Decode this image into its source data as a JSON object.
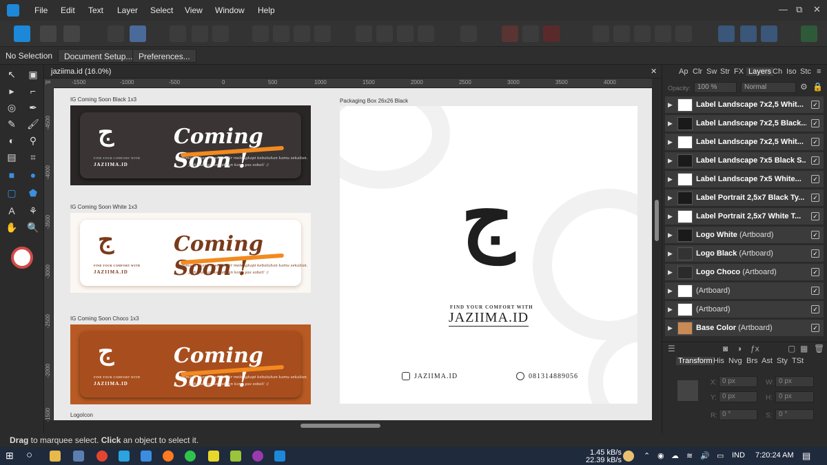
{
  "menubar": {
    "items": [
      "File",
      "Edit",
      "Text",
      "Layer",
      "Select",
      "View",
      "Window",
      "Help"
    ],
    "window_controls": {
      "minimize": "—",
      "restore": "⧉",
      "close": "✕"
    }
  },
  "context": {
    "selection": "No Selection",
    "document_setup": "Document Setup...",
    "preferences": "Preferences..."
  },
  "document": {
    "tab_title": "jaziima.id (16.0%)",
    "close": "✕",
    "ruler_unit": "px",
    "ruler_h": [
      "-1500",
      "-1000",
      "-500",
      "0",
      "500",
      "1000",
      "1500",
      "2000",
      "2500",
      "3000",
      "3500",
      "4000"
    ],
    "ruler_v": [
      "-4500",
      "-4000",
      "-3500",
      "-3000",
      "-2500",
      "-2000",
      "-1500"
    ]
  },
  "artboards": {
    "black": {
      "label": "IG Coming Soon Black 1x3",
      "title": "Coming Soon !",
      "brand": "JAZIIMA.ID",
      "brand_sub": "FIND YOUR COMFORT WITH",
      "line1": "jaziima.id akan segera hadir melengkapi kebutuhan kamu sekalian.",
      "line2": "Jadi, tunggu kehadiran kami yaa sobat! :)",
      "mark": "ج"
    },
    "white": {
      "label": "IG Coming Soon White 1x3",
      "title": "Coming Soon !",
      "brand": "JAZIIMA.ID",
      "brand_sub": "FIND YOUR COMFORT WITH",
      "line1": "jaziima.id akan segera hadir melengkapi kebutuhan kamu sekalian.",
      "line2": "Jadi, tunggu kehadiran kami yaa sobat! :)",
      "mark": "ج"
    },
    "choco": {
      "label": "IG Coming Soon Choco 1x3",
      "title": "Coming Soon !",
      "brand": "JAZIIMA.ID",
      "brand_sub": "FIND YOUR COMFORT WITH",
      "line1": "jaziima.id akan segera hadir melengkapi kebutuhan kamu sekalian.",
      "line2": "Jadi, tunggu kehadiran kami yaa sobat! :)",
      "mark": "ج"
    },
    "logoicon": {
      "label": "LogoIcon"
    },
    "box": {
      "label": "Packaging Box 26x26 Black",
      "mark": "ج",
      "tagline": "FIND YOUR COMFORT WITH",
      "brand": "JAZIIMA.ID",
      "instagram": "JAZIIMA.ID",
      "whatsapp": "081314889056"
    }
  },
  "panel": {
    "tabs": [
      "Ap",
      "Clr",
      "Sw",
      "Str",
      "FX",
      "Layers",
      "Ch",
      "Iso",
      "Stc"
    ],
    "active_tab": "Layers",
    "opacity_label": "Opacity:",
    "opacity": "100 %",
    "blend": "Normal",
    "layers": [
      {
        "name": "Label Landscape 7x2,5 Whit...",
        "sub": "",
        "thumb": "#ffffff"
      },
      {
        "name": "Label Landscape 7x2,5 Black...",
        "sub": "",
        "thumb": "#1a1a1a"
      },
      {
        "name": "Label Landscape 7x2,5 Whit...",
        "sub": "",
        "thumb": "#ffffff"
      },
      {
        "name": "Label Landscape 7x5 Black S...",
        "sub": "",
        "thumb": "#1a1a1a"
      },
      {
        "name": "Label Landscape 7x5 White...",
        "sub": "",
        "thumb": "#ffffff"
      },
      {
        "name": "Label Portrait 2,5x7 Black Ty...",
        "sub": "",
        "thumb": "#1a1a1a"
      },
      {
        "name": "Label Portrait 2,5x7 White T...",
        "sub": "",
        "thumb": "#ffffff"
      },
      {
        "name": "Logo White",
        "sub": "(Artboard)",
        "thumb": "#1a1a1a"
      },
      {
        "name": "Logo Black",
        "sub": "(Artboard)",
        "thumb": "#333333"
      },
      {
        "name": "Logo Choco",
        "sub": "(Artboard)",
        "thumb": "#2b2b2b"
      },
      {
        "name": "",
        "sub": "(Artboard)",
        "thumb": "#ffffff"
      },
      {
        "name": "",
        "sub": "(Artboard)",
        "thumb": "#ffffff"
      },
      {
        "name": "Base Color",
        "sub": "(Artboard)",
        "thumb": "#c98a55"
      }
    ],
    "bottom_tabs": [
      "Transform",
      "His",
      "Nvg",
      "Brs",
      "Ast",
      "Sty",
      "TSt"
    ],
    "active_bottom_tab": "Transform",
    "transform": {
      "x_label": "X:",
      "y_label": "Y:",
      "w_label": "W:",
      "h_label": "H:",
      "r_label": "R:",
      "s_label": "S:",
      "x": "0 px",
      "y": "0 px",
      "w": "0 px",
      "h": "0 px",
      "r": "0 °",
      "s": "0 °"
    }
  },
  "status": {
    "bold1": "Drag",
    "text1": " to marquee select. ",
    "bold2": "Click",
    "text2": " an object to select it."
  },
  "taskbar": {
    "net_up": "1.45 kB/s",
    "net_down": "22.39 kB/s",
    "lang": "IND",
    "time": "7:20:24 AM"
  },
  "colors": {
    "accent": "#1d88d9",
    "choco": "#b85a24",
    "black_banner": "#2a2626",
    "orange": "#f28a1f",
    "brown_text": "#7a3b1b"
  }
}
